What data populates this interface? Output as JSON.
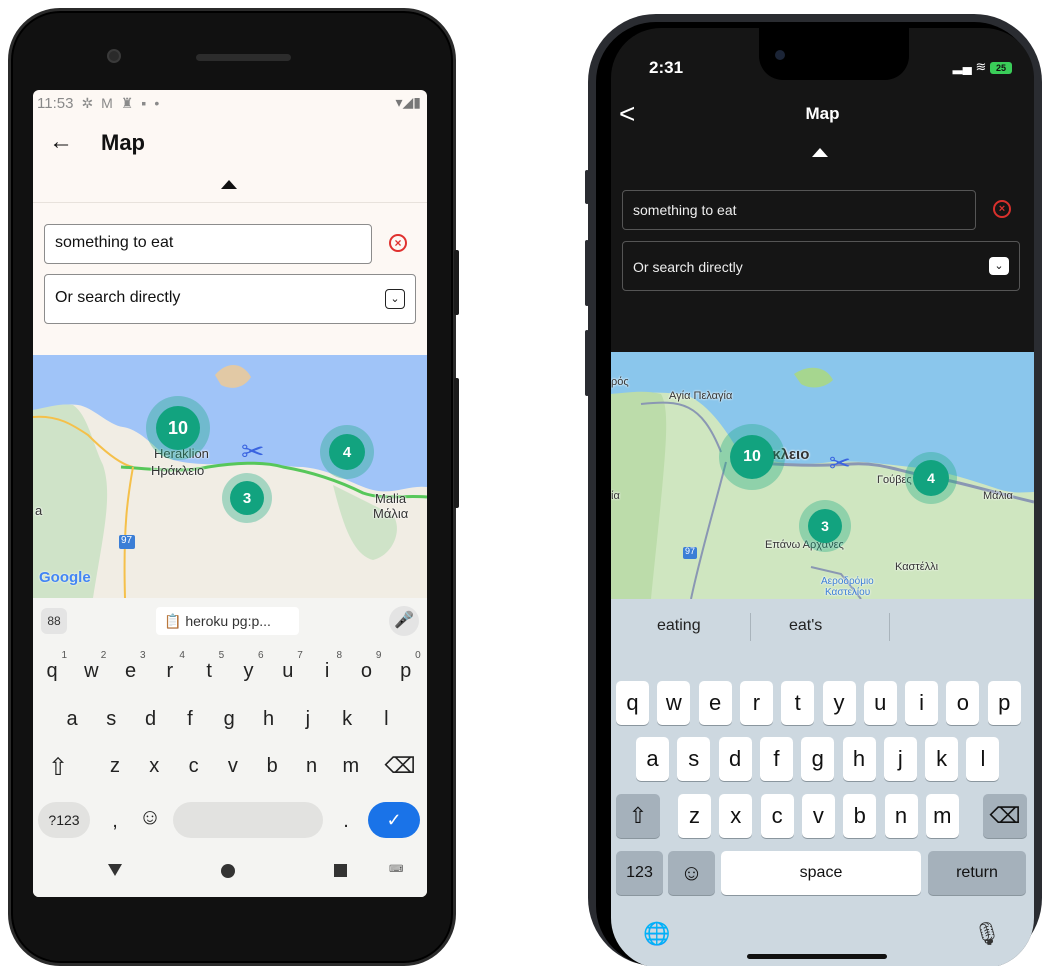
{
  "android": {
    "status": {
      "time": "11:53",
      "icons": [
        "gear-icon",
        "mail-icon",
        "person-icon",
        "sim-icon",
        "dot-icon"
      ],
      "right": "▾◢▮"
    },
    "appbar": {
      "back_glyph": "←",
      "title": "Map"
    },
    "search": {
      "value": "something to eat",
      "clear_glyph": "×"
    },
    "select": {
      "value": "Or search directly",
      "chev_glyph": "⌄"
    },
    "map": {
      "labels": [
        "Heraklion",
        "Ηράκλειο",
        "Malia",
        "Μάλια",
        "97",
        "a"
      ],
      "clusters": [
        "10",
        "4",
        "3"
      ],
      "google": "Google"
    },
    "keyboard": {
      "grid_glyph": "88",
      "clipboard": "heroku pg:p...",
      "row1": [
        "q",
        "w",
        "e",
        "r",
        "t",
        "y",
        "u",
        "i",
        "o",
        "p"
      ],
      "row1_nums": [
        "1",
        "2",
        "3",
        "4",
        "5",
        "6",
        "7",
        "8",
        "9",
        "0"
      ],
      "row2": [
        "a",
        "s",
        "d",
        "f",
        "g",
        "h",
        "j",
        "k",
        "l"
      ],
      "row3": [
        "z",
        "x",
        "c",
        "v",
        "b",
        "n",
        "m"
      ],
      "shift_glyph": "⇧",
      "backspace_glyph": "⌫",
      "symbols": "?123",
      "comma": ",",
      "emoji_glyph": "☺",
      "period": ".",
      "enter_glyph": "✓",
      "kb_switch_glyph": "⌨"
    }
  },
  "ios": {
    "status": {
      "time": "2:31",
      "signal": "▂▄",
      "battery": "25"
    },
    "back_glyph": "<",
    "title": "Map",
    "search": {
      "value": "something to eat",
      "clear_glyph": "×"
    },
    "select": {
      "value": "Or search directly",
      "chev_glyph": "⌄"
    },
    "map": {
      "labels": [
        "Αγία Πελαγία",
        "άκλειο",
        "Γούβες",
        "Μάλια",
        "Επάνω Αρχάνες",
        "Καστέλλι",
        "Αεροδρόμιο",
        "Καστελίου",
        "ρός",
        "ία",
        "97"
      ],
      "clusters": [
        "10",
        "4",
        "3"
      ]
    },
    "keyboard": {
      "suggestions": [
        "eating",
        "eat's"
      ],
      "row1": [
        "q",
        "w",
        "e",
        "r",
        "t",
        "y",
        "u",
        "i",
        "o",
        "p"
      ],
      "row2": [
        "a",
        "s",
        "d",
        "f",
        "g",
        "h",
        "j",
        "k",
        "l"
      ],
      "row3": [
        "z",
        "x",
        "c",
        "v",
        "b",
        "n",
        "m"
      ],
      "shift_glyph": "⇧",
      "backspace_glyph": "⌫",
      "numbers": "123",
      "emoji_glyph": "☺",
      "space": "space",
      "return": "return",
      "globe_glyph": "🌐",
      "mic_glyph": "🎙"
    }
  },
  "colors": {
    "cluster": "#12a37f",
    "sea": "#a0c4f8",
    "land": "#f3efe6",
    "android_enter": "#1a73e8",
    "clear": "#e0312f"
  }
}
